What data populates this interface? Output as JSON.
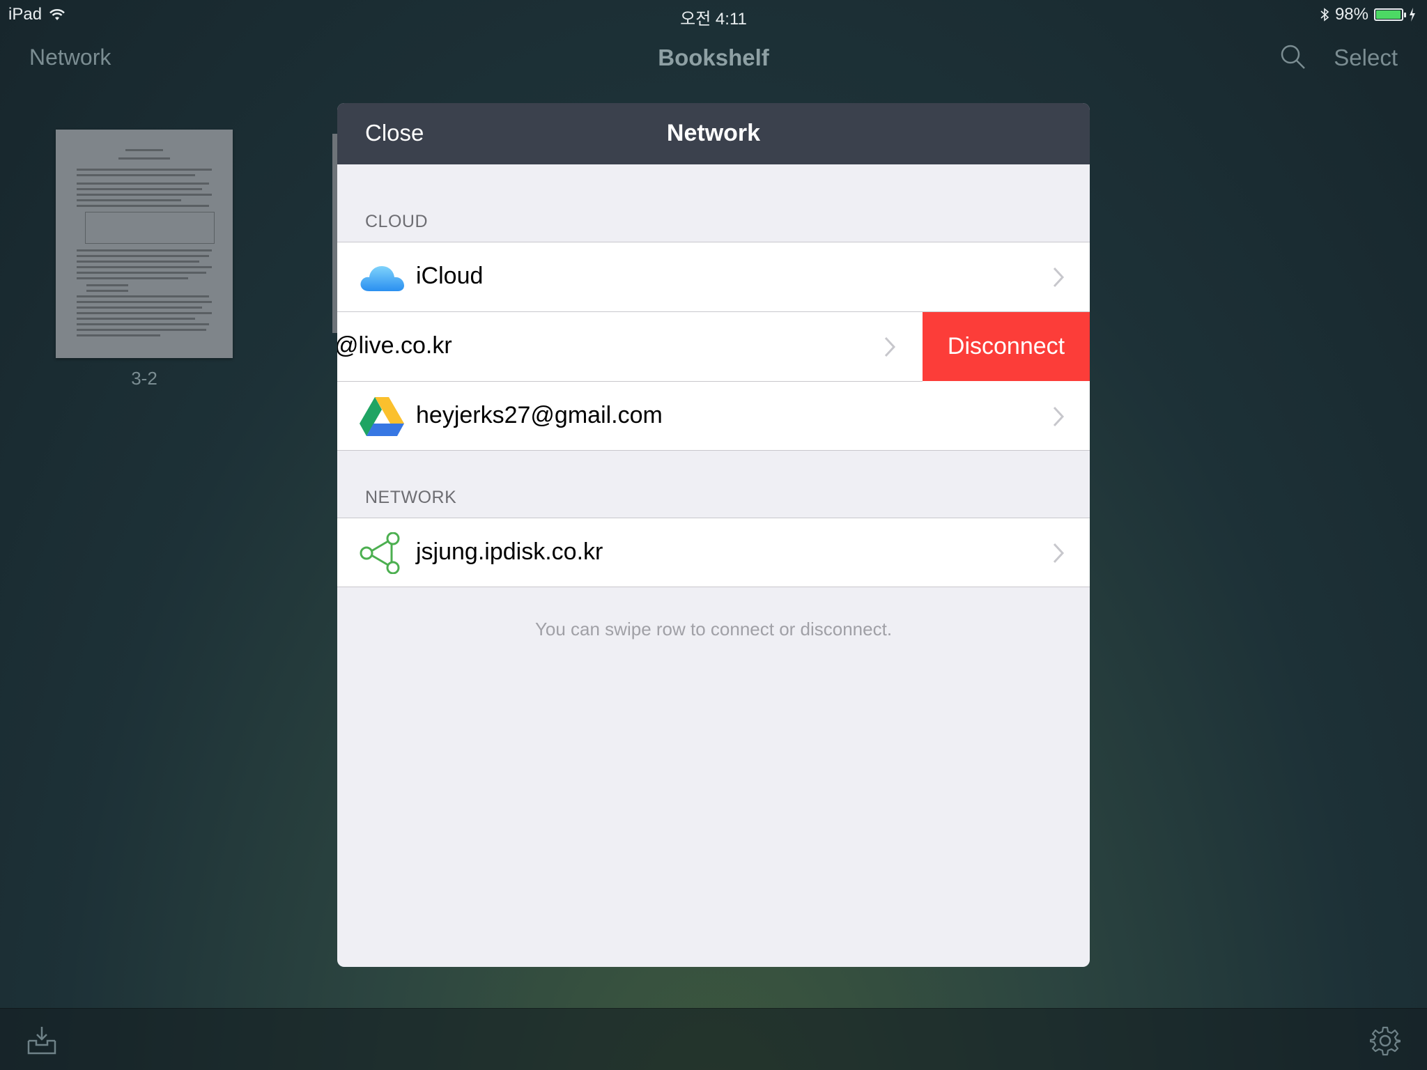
{
  "status": {
    "device": "iPad",
    "time": "오전 4:11",
    "battery": "98%",
    "battery_level": 0.98,
    "battery_color": "#4cd964"
  },
  "nav": {
    "left": "Network",
    "title": "Bookshelf",
    "search_icon": "search-icon",
    "right": "Select"
  },
  "shelf": {
    "book_title": "3-2"
  },
  "modal": {
    "close": "Close",
    "title": "Network",
    "cloud_header": "CLOUD",
    "cloud_items": [
      {
        "label": "iCloud",
        "icon": "icloud-icon"
      },
      {
        "label": "@live.co.kr",
        "icon": "onedrive-icon",
        "action": "Disconnect"
      },
      {
        "label": "heyjerks27@gmail.com",
        "icon": "google-drive-icon"
      }
    ],
    "network_header": "NETWORK",
    "network_items": [
      {
        "label": "jsjung.ipdisk.co.kr",
        "icon": "network-share-icon"
      }
    ],
    "hint": "You can swipe row to connect or disconnect.",
    "accent_destructive": "#fc3d39"
  },
  "toolbar": {
    "left_icon": "import-tray-icon",
    "right_icon": "gear-icon"
  }
}
